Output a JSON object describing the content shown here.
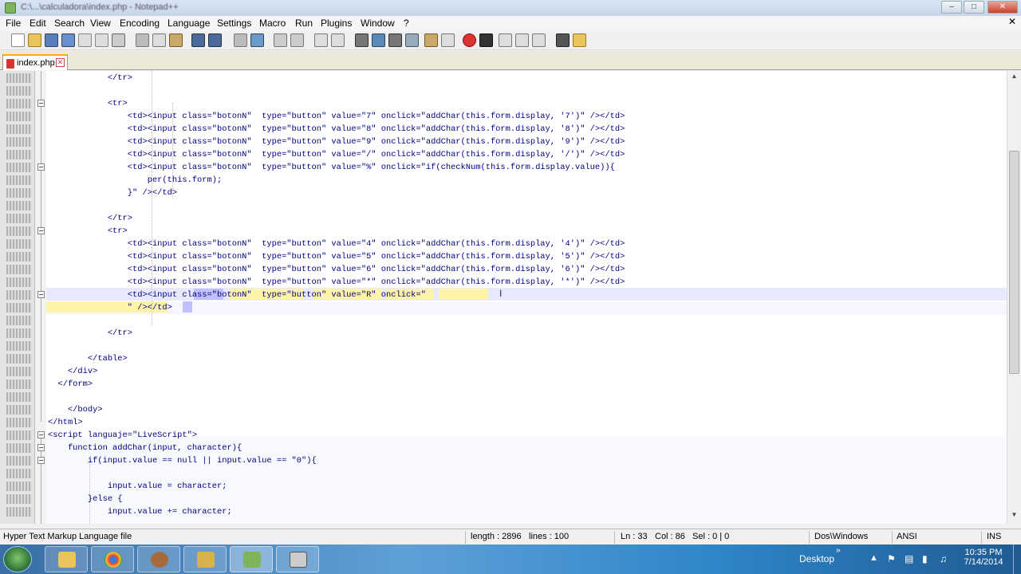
{
  "window": {
    "title": "C:\\...\\calculadora\\index.php - Notepad++"
  },
  "menu": [
    "File",
    "Edit",
    "Search",
    "View",
    "Encoding",
    "Language",
    "Settings",
    "Macro",
    "Run",
    "Plugins",
    "Window",
    "?"
  ],
  "tab": {
    "label": "index.php"
  },
  "code_lines": [
    {
      "text": "            </tr>"
    },
    {
      "text": ""
    },
    {
      "text": "            <tr>"
    },
    {
      "text": "                <td><input class=\"botonN\"  type=\"button\" value=\"7\" onclick=\"addChar(this.form.display, '7')\" /></td>"
    },
    {
      "text": "                <td><input class=\"botonN\"  type=\"button\" value=\"8\" onclick=\"addChar(this.form.display, '8')\" /></td>"
    },
    {
      "text": "                <td><input class=\"botonN\"  type=\"button\" value=\"9\" onclick=\"addChar(this.form.display, '9')\" /></td>"
    },
    {
      "text": "                <td><input class=\"botonN\"  type=\"button\" value=\"/\" onclick=\"addChar(this.form.display, '/')\" /></td>"
    },
    {
      "text": "                <td><input class=\"botonN\"  type=\"button\" value=\"%\" onclick=\"if(checkNum(this.form.display.value)){"
    },
    {
      "text": "                    per(this.form);"
    },
    {
      "text": "                }\" /></td>"
    },
    {
      "text": ""
    },
    {
      "text": "            </tr>"
    },
    {
      "text": "            <tr>"
    },
    {
      "text": "                <td><input class=\"botonN\"  type=\"button\" value=\"4\" onclick=\"addChar(this.form.display, '4')\" /></td>"
    },
    {
      "text": "                <td><input class=\"botonN\"  type=\"button\" value=\"5\" onclick=\"addChar(this.form.display, '5')\" /></td>"
    },
    {
      "text": "                <td><input class=\"botonN\"  type=\"button\" value=\"6\" onclick=\"addChar(this.form.display, '6')\" /></td>"
    },
    {
      "text": "                <td><input class=\"botonN\"  type=\"button\" value=\"*\" onclick=\"addChar(this.form.display, '*')\" /></td>"
    },
    {
      "text": "                <td><input class=\"botonN\"  type=\"button\" value=\"R\" onclick=\""
    },
    {
      "text": "                \" /></td>"
    },
    {
      "text": ""
    },
    {
      "text": "            </tr>"
    },
    {
      "text": ""
    },
    {
      "text": "        </table>"
    },
    {
      "text": "    </div>"
    },
    {
      "text": "  </form>"
    },
    {
      "text": ""
    },
    {
      "text": "    </body>"
    },
    {
      "text": "</html>"
    },
    {
      "text": "<script languaje=\"LiveScript\">"
    },
    {
      "text": "    function addChar(input, character){"
    },
    {
      "text": "        if(input.value == null || input.value == \"0\"){"
    },
    {
      "text": ""
    },
    {
      "text": "            input.value = character;"
    },
    {
      "text": "        }else {"
    },
    {
      "text": "            input.value += character;"
    }
  ],
  "status": {
    "filetype": "Hyper Text Markup Language file",
    "length": "length : 2896",
    "lines": "lines : 100",
    "ln": "Ln : 33",
    "col": "Col : 86",
    "sel": "Sel : 0 | 0",
    "eol": "Dos\\Windows",
    "encoding": "ANSI",
    "mode": "INS"
  },
  "taskbar": {
    "desktop_label": "Desktop",
    "time": "10:35 PM",
    "date": "7/14/2014"
  },
  "colors": {
    "accent": "#fa0",
    "current_line": "#e8e8ff",
    "selection": "#c0c0ff",
    "tag_blue": "#000080"
  }
}
